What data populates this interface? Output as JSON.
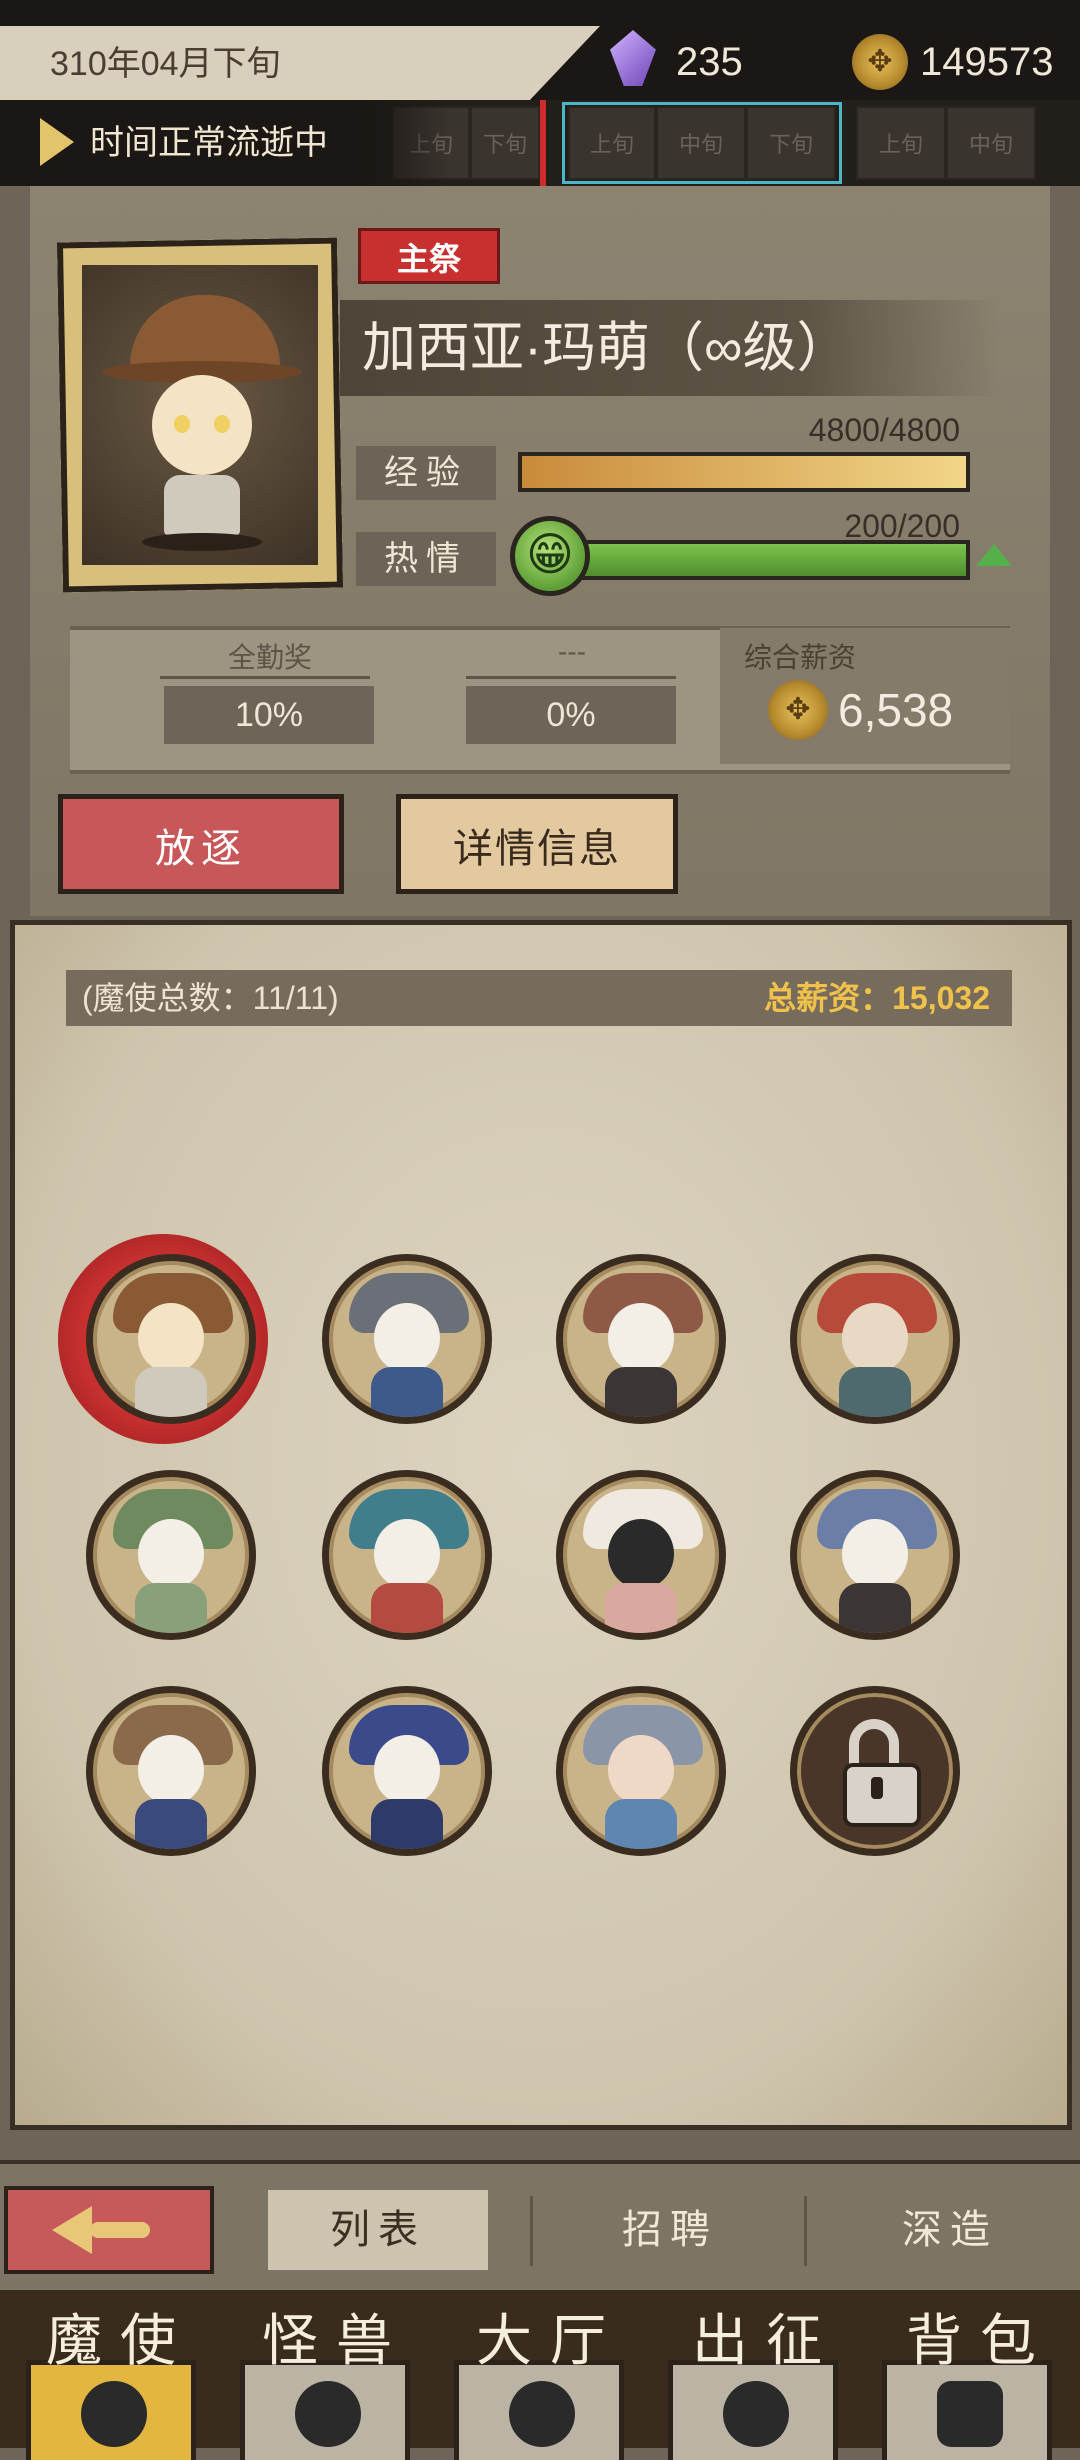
{
  "top_bar": {
    "date": "310年04月下旬",
    "crystal_count": "235",
    "coin_count": "149573",
    "coin_glyph": "✥"
  },
  "time_bar": {
    "status": "时间正常流逝中",
    "slots_prev": [
      "上旬",
      "下旬"
    ],
    "slots_now": [
      "上旬",
      "中旬",
      "下旬"
    ],
    "slots_next": [
      "上旬",
      "中旬"
    ]
  },
  "character": {
    "role_badge": "主祭",
    "name": "加西亚·玛萌（∞级）",
    "exp_label": "经验",
    "exp_value": "4800/4800",
    "exp_fraction": 1.0,
    "passion_label": "热情",
    "passion_value": "200/200",
    "passion_fraction": 1.0,
    "smile_glyph": "😁"
  },
  "bonus": {
    "attendance_title": "全勤奖",
    "attendance_value": "10%",
    "other_title": "---",
    "other_value": "0%",
    "salary_title": "综合薪资",
    "salary_value": "6,538"
  },
  "actions": {
    "exile": "放逐",
    "details": "详情信息"
  },
  "roster": {
    "count_label": "(魔使总数：11/11)",
    "total_salary_label": "总薪资：15,032"
  },
  "sub_nav": {
    "tabs": [
      "列表",
      "招聘",
      "深造"
    ]
  },
  "main_nav": {
    "tabs": [
      "魔使",
      "怪兽",
      "大厅",
      "出征",
      "背包"
    ]
  },
  "colors": {
    "accent_red": "#c8575a",
    "gold": "#e8c15a",
    "exp_bar": "#e7b866",
    "passion_bar": "#5ea037",
    "timeline_highlight": "#4cb6c9"
  }
}
